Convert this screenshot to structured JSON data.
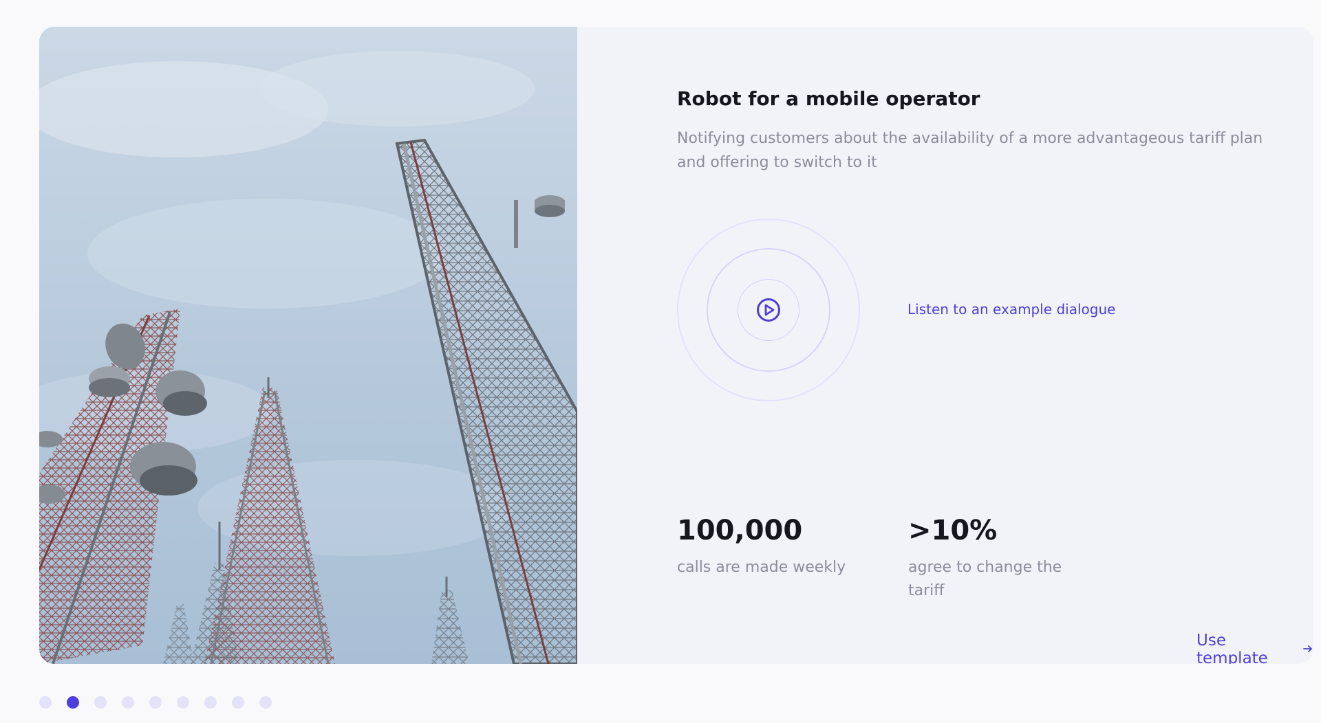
{
  "card": {
    "title": "Robot for a mobile operator",
    "description": "Notifying customers about the availability of a more advantageous tariff plan and offering to switch to it",
    "listen_label": "Listen to an example dialogue",
    "stats": [
      {
        "value": "100,000",
        "label": "calls are made weekly"
      },
      {
        "value": ">10%",
        "label": "agree to change the tariff"
      }
    ],
    "cta_label": "Use template",
    "cta_icon": "arrow-right-icon",
    "play_icon": "play-circle-icon",
    "image": "telecom-towers-photo"
  },
  "pagination": {
    "total": 9,
    "active_index": 1
  },
  "colors": {
    "accent": "#4d3fd6",
    "dot_active": "#4b3fe0",
    "dot_inactive": "#e4e2f8",
    "card_bg": "#f2f3f9"
  }
}
